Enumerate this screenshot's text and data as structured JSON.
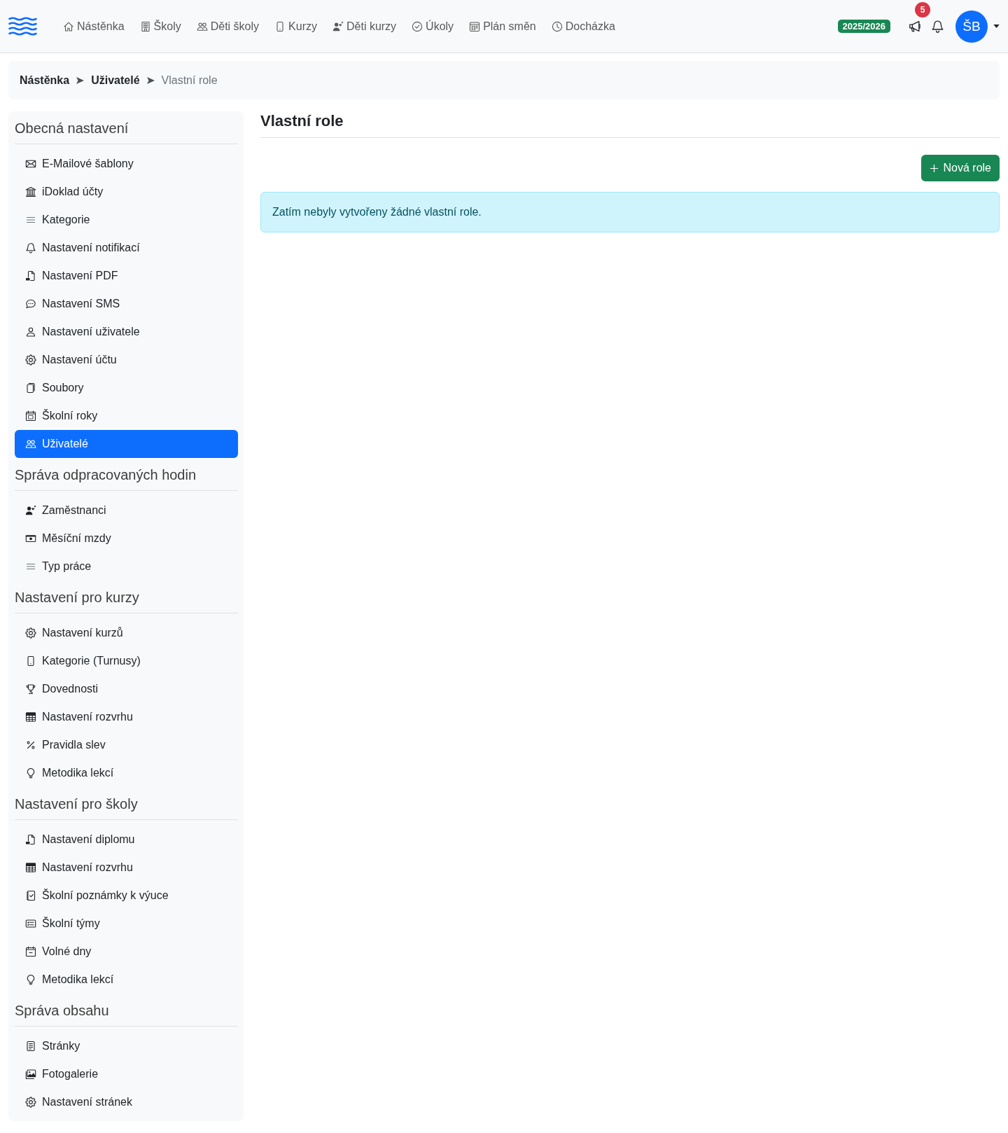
{
  "navbar": {
    "links": [
      {
        "label": "Nástěnka"
      },
      {
        "label": "Školy"
      },
      {
        "label": "Děti školy"
      },
      {
        "label": "Kurzy"
      },
      {
        "label": "Děti kurzy"
      },
      {
        "label": "Úkoly"
      },
      {
        "label": "Plán směn"
      },
      {
        "label": "Docházka"
      }
    ],
    "school_year": "2025/2026",
    "announcements_count": "5",
    "user_initials": "ŠB"
  },
  "breadcrumb": [
    {
      "label": "Nástěnka",
      "current": false
    },
    {
      "label": "Uživatelé",
      "current": false
    },
    {
      "label": "Vlastní role",
      "current": true
    }
  ],
  "sidebar": {
    "sections": [
      {
        "title": "Obecná nastavení",
        "items": [
          {
            "label": "E-Mailové šablony",
            "selected": false
          },
          {
            "label": "iDoklad účty",
            "selected": false
          },
          {
            "label": "Kategorie",
            "selected": false
          },
          {
            "label": "Nastavení notifikací",
            "selected": false
          },
          {
            "label": "Nastavení PDF",
            "selected": false
          },
          {
            "label": "Nastavení SMS",
            "selected": false
          },
          {
            "label": "Nastavení uživatele",
            "selected": false
          },
          {
            "label": "Nastavení účtu",
            "selected": false
          },
          {
            "label": "Soubory",
            "selected": false
          },
          {
            "label": "Školní roky",
            "selected": false
          },
          {
            "label": "Uživatelé",
            "selected": true
          }
        ]
      },
      {
        "title": "Správa odpracovaných hodin",
        "items": [
          {
            "label": "Zaměstnanci",
            "selected": false
          },
          {
            "label": "Měsíční mzdy",
            "selected": false
          },
          {
            "label": "Typ práce",
            "selected": false
          }
        ]
      },
      {
        "title": "Nastavení pro kurzy",
        "items": [
          {
            "label": "Nastavení kurzů",
            "selected": false
          },
          {
            "label": "Kategorie (Turnusy)",
            "selected": false
          },
          {
            "label": "Dovednosti",
            "selected": false
          },
          {
            "label": "Nastavení rozvrhu",
            "selected": false
          },
          {
            "label": "Pravidla slev",
            "selected": false
          },
          {
            "label": "Metodika lekcí",
            "selected": false
          }
        ]
      },
      {
        "title": "Nastavení pro školy",
        "items": [
          {
            "label": "Nastavení diplomu",
            "selected": false
          },
          {
            "label": "Nastavení rozvrhu",
            "selected": false
          },
          {
            "label": "Školní poznámky k výuce",
            "selected": false
          },
          {
            "label": "Školní týmy",
            "selected": false
          },
          {
            "label": "Volné dny",
            "selected": false
          },
          {
            "label": "Metodika lekcí",
            "selected": false
          }
        ]
      },
      {
        "title": "Správa obsahu",
        "items": [
          {
            "label": "Stránky",
            "selected": false
          },
          {
            "label": "Fotogalerie",
            "selected": false
          },
          {
            "label": "Nastavení stránek",
            "selected": false
          }
        ]
      }
    ]
  },
  "main": {
    "title": "Vlastní role",
    "new_button": "Nová role",
    "alert": "Zatím nebyly vytvořeny žádné vlastní role."
  }
}
